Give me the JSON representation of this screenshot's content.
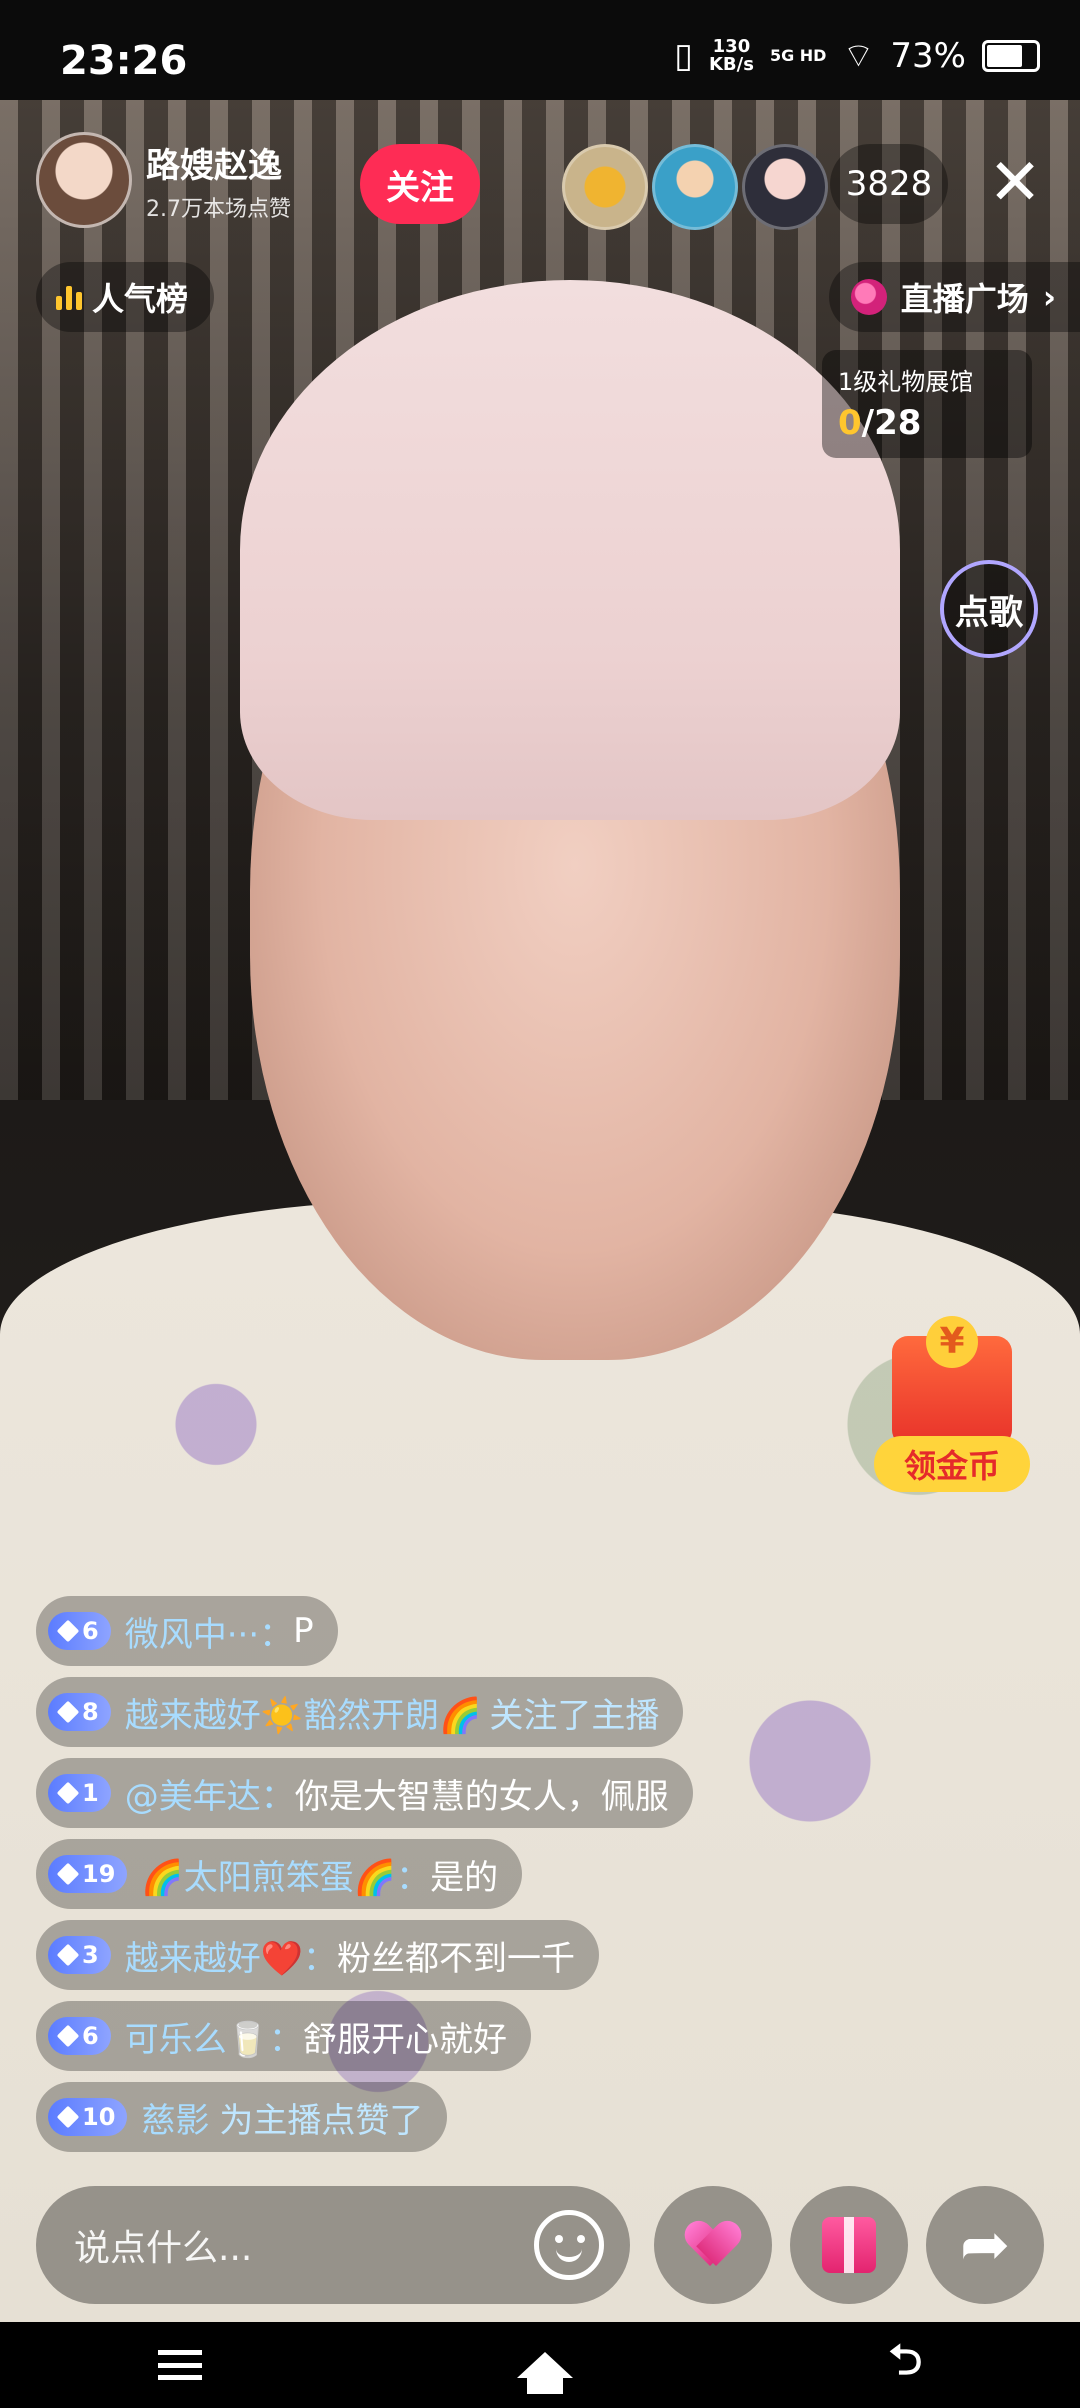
{
  "status_bar": {
    "time": "23:26",
    "net_speed_value": "130",
    "net_speed_unit": "KB/s",
    "network": "5G HD",
    "battery": "73%"
  },
  "host": {
    "name": "路嫂赵逸",
    "likes": "2.7万本场点赞",
    "follow_label": "关注"
  },
  "viewers": {
    "count": "3828"
  },
  "close_icon": "✕",
  "rank": {
    "label": "人气榜"
  },
  "live_square": {
    "label": "直播广场",
    "chevron": "›"
  },
  "gift_hall": {
    "title": "1级礼物展馆",
    "current": "0",
    "total": "/28"
  },
  "song_button": {
    "label": "点歌"
  },
  "coins": {
    "label": "领金币"
  },
  "chat": [
    {
      "level": "6",
      "user": "微风中···：",
      "text": "P"
    },
    {
      "level": "8",
      "user": "越来越好☀️豁然开朗🌈",
      "text": "关注了主播",
      "notice": true
    },
    {
      "level": "1",
      "user": "@美年达：",
      "text": "你是大智慧的女人，佩服"
    },
    {
      "level": "19",
      "user": "🌈太阳煎笨蛋🌈：",
      "text": "是的"
    },
    {
      "level": "3",
      "user": "越来越好❤️：",
      "text": "粉丝都不到一千"
    },
    {
      "level": "6",
      "user": "可乐么🥛：",
      "text": "舒服开心就好"
    },
    {
      "level": "10",
      "user": "慈影",
      "text": "为主播点赞了",
      "notice": true
    }
  ],
  "input": {
    "placeholder": "说点什么..."
  },
  "share_icon": "➦",
  "navbar": {
    "back_icon": "⮌"
  }
}
